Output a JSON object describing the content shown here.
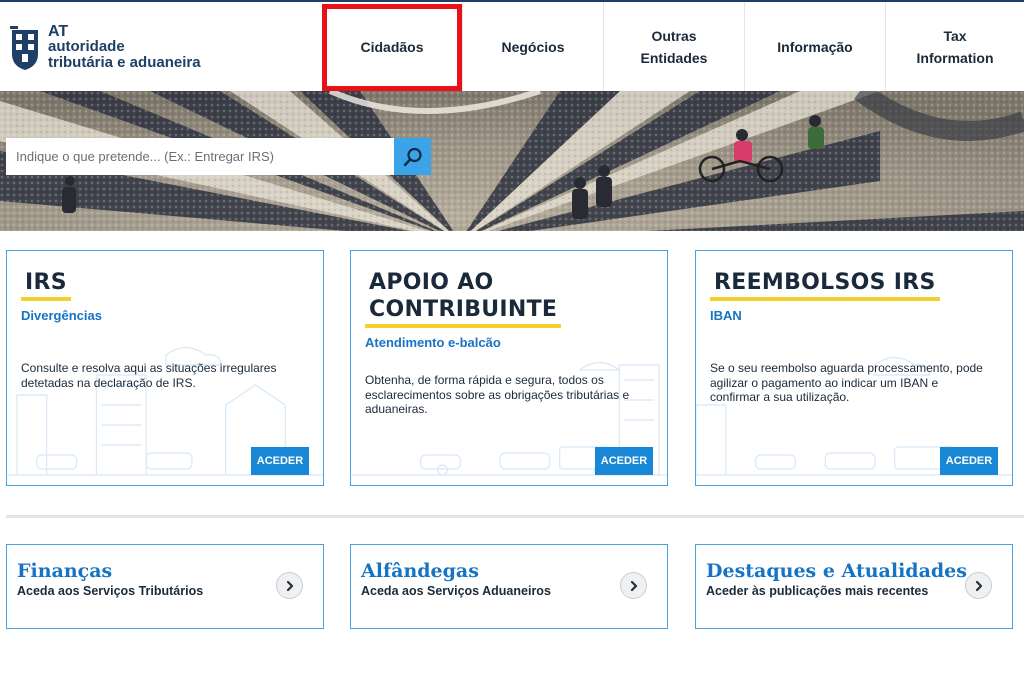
{
  "header": {
    "logo": {
      "line1": "AT",
      "line2": "autoridade",
      "line3": "tributária e aduaneira"
    },
    "nav": [
      {
        "label": "Cidadãos"
      },
      {
        "label": "Negócios"
      },
      {
        "label": "Outras Entidades"
      },
      {
        "label": "Informação"
      },
      {
        "label": "Tax Information"
      }
    ]
  },
  "search": {
    "placeholder": "Indique o que pretende... (Ex.: Entregar IRS)",
    "icon": "search-icon"
  },
  "cards": [
    {
      "title": "IRS",
      "subtitle": "Divergências",
      "description": "Consulte e resolva aqui as situações irregulares detetadas na declaração de IRS.",
      "button": "ACEDER"
    },
    {
      "title_line1": "APOIO AO",
      "title_line2": "CONTRIBUINTE",
      "subtitle": "Atendimento e-balcão",
      "description": "Obtenha, de forma rápida e segura, todos os esclarecimentos sobre as obrigações tributárias e aduaneiras.",
      "button": "ACEDER"
    },
    {
      "title": "REEMBOLSOS IRS",
      "subtitle": "IBAN",
      "description": "Se o seu reembolso aguarda processamento, pode agilizar o pagamento ao indicar um IBAN e confirmar a sua utilização.",
      "button": "ACEDER"
    }
  ],
  "links": [
    {
      "title": "Finanças",
      "subtitle": "Aceda aos Serviços Tributários",
      "icon": "chevron-right-icon"
    },
    {
      "title": "Alfândegas",
      "subtitle": "Aceda aos Serviços Aduaneiros",
      "icon": "chevron-right-icon"
    },
    {
      "title": "Destaques e Atualidades",
      "subtitle": "Aceder às publicações mais recentes",
      "icon": "chevron-right-icon"
    }
  ],
  "colors": {
    "brand_navy": "#1e3f66",
    "link_blue": "#1773c4",
    "button_blue": "#1888d6",
    "search_blue": "#3ba3e8",
    "underline_yellow": "#f5cf2c",
    "highlight_red": "#e8111a"
  }
}
